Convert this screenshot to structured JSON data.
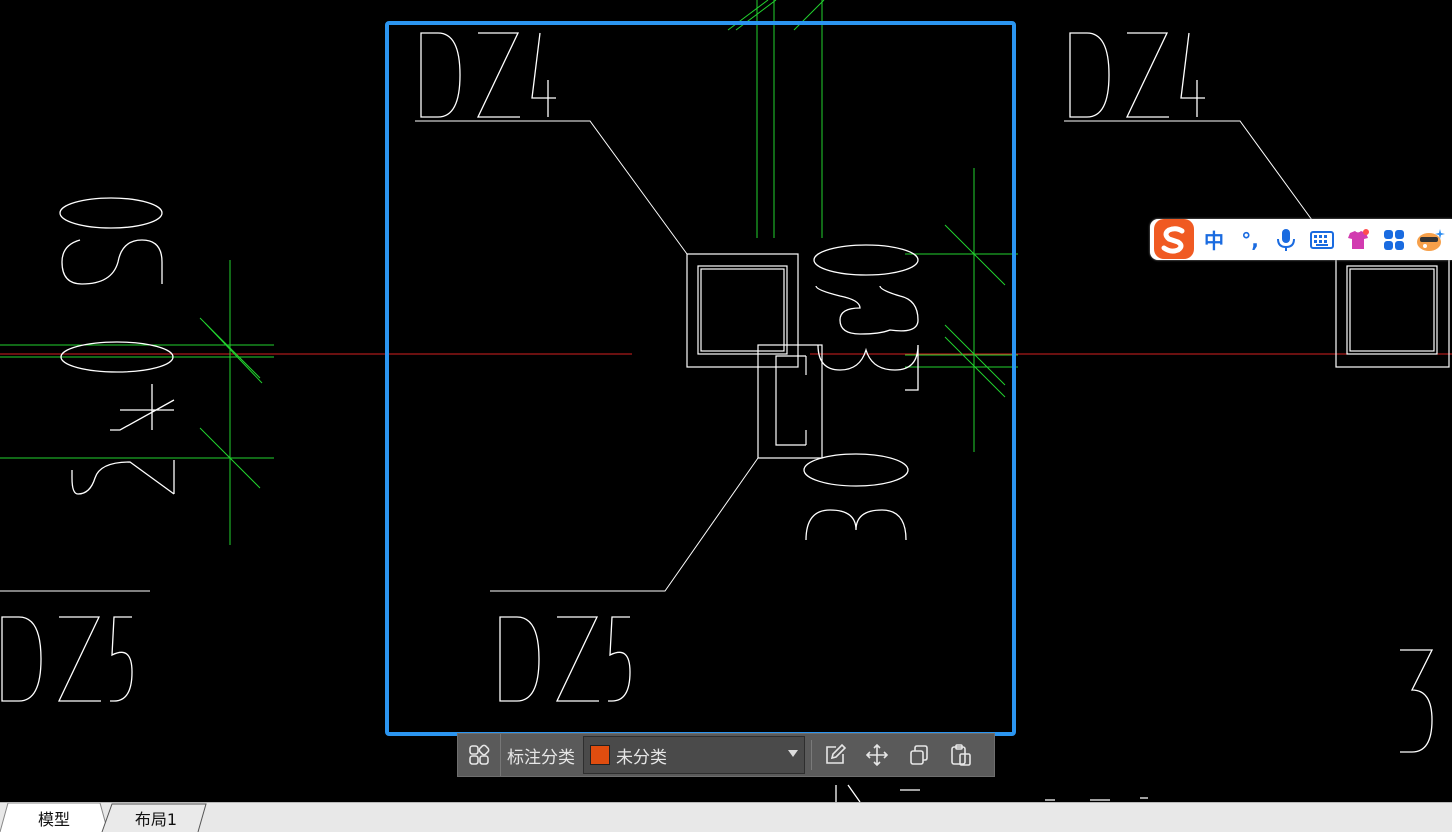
{
  "canvas": {
    "labels": [
      "DZ4",
      "DZ4",
      "DZ5",
      "DZ5",
      "2",
      "3"
    ],
    "dimensions": [
      "2 4 0 2 0",
      "3 0 2 3 0",
      "3 0 3 0"
    ]
  },
  "toolbar": {
    "label": "标注分类",
    "category_value": "未分类",
    "category_color": "#e04d0f",
    "icons": [
      "grid-icon",
      "edit-icon",
      "move-icon",
      "copy-icon",
      "paste-icon"
    ]
  },
  "ime": {
    "mode": "中",
    "punct": "°,",
    "icons": [
      "sogou-logo-icon",
      "mic-icon",
      "keyboard-icon",
      "skin-icon",
      "toolbox-icon",
      "mascot-icon"
    ]
  },
  "tabs": [
    "模型",
    "布局1"
  ]
}
